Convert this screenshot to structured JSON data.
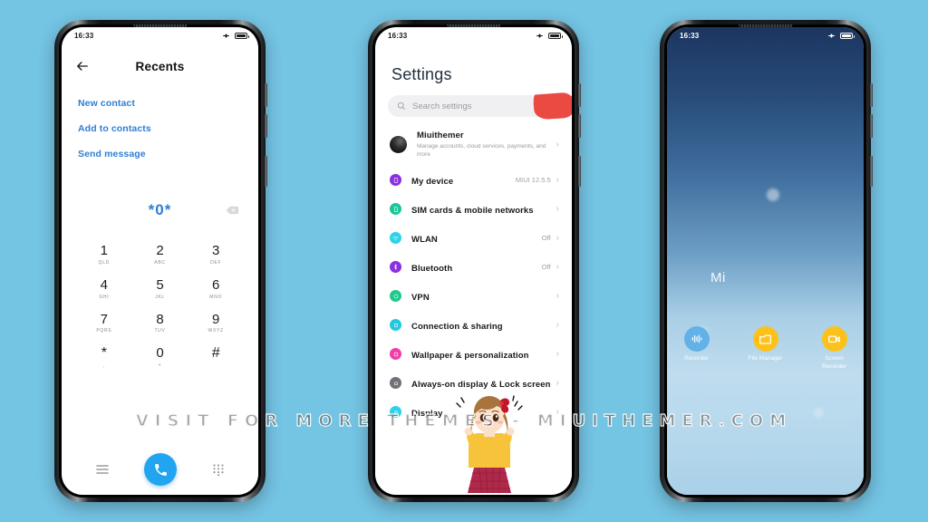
{
  "background_color": "#74c4e4",
  "watermark": {
    "text": "VISIT  FOR  MORE  THEMES  -  MIUITHEMER.COM"
  },
  "phones": {
    "dialer": {
      "status_bar": {
        "time": "16:33",
        "icons": [
          "airplane-mode-icon",
          "battery-icon"
        ]
      },
      "header": {
        "back_label": "back-arrow-icon",
        "title": "Recents"
      },
      "actions": [
        {
          "label": "New contact"
        },
        {
          "label": "Add to contacts"
        },
        {
          "label": "Send message"
        }
      ],
      "display": {
        "number": "*0*",
        "delete_label": "backspace-icon"
      },
      "keys": [
        {
          "digit": "1",
          "letters": "QLD"
        },
        {
          "digit": "2",
          "letters": "ABC"
        },
        {
          "digit": "3",
          "letters": "DEF"
        },
        {
          "digit": "4",
          "letters": "GHI"
        },
        {
          "digit": "5",
          "letters": "JKL"
        },
        {
          "digit": "6",
          "letters": "MNO"
        },
        {
          "digit": "7",
          "letters": "PQRS"
        },
        {
          "digit": "8",
          "letters": "TUV"
        },
        {
          "digit": "9",
          "letters": "WXYZ"
        },
        {
          "digit": "*",
          "letters": ","
        },
        {
          "digit": "0",
          "letters": "+"
        },
        {
          "digit": "#",
          "letters": ""
        }
      ],
      "bottom_bar": {
        "menu_label": "menu-icon",
        "call_label": "call-icon",
        "keypad_label": "keypad-icon",
        "call_button_color": "#21a5f1"
      },
      "link_color": "#2e7fd4"
    },
    "settings": {
      "status_bar": {
        "time": "16:33",
        "icons": [
          "airplane-mode-icon",
          "battery-icon"
        ]
      },
      "title": "Settings",
      "search": {
        "placeholder": "Search settings",
        "icon": "search-icon"
      },
      "blob_color": "#ea4a42",
      "items": [
        {
          "label": "Miuithemer",
          "sub": "Manage accounts, cloud services, payments, and more",
          "value": "",
          "icon": "account-avatar",
          "icon_color": "#2b2b2b"
        },
        {
          "label": "My device",
          "sub": "",
          "value": "MIUI 12.5.5",
          "icon": "phone-icon",
          "icon_color": "#8b2fe0"
        },
        {
          "label": "SIM cards & mobile networks",
          "sub": "",
          "value": "",
          "icon": "sim-card-icon",
          "icon_color": "#19c79a"
        },
        {
          "label": "WLAN",
          "sub": "",
          "value": "Off",
          "icon": "wifi-icon",
          "icon_color": "#2fd2e8"
        },
        {
          "label": "Bluetooth",
          "sub": "",
          "value": "Off",
          "icon": "bluetooth-icon",
          "icon_color": "#8b2fe0"
        },
        {
          "label": "VPN",
          "sub": "",
          "value": "",
          "icon": "vpn-icon",
          "icon_color": "#1fc98c"
        },
        {
          "label": "Connection & sharing",
          "sub": "",
          "value": "",
          "icon": "connection-sharing-icon",
          "icon_color": "#22c8de"
        },
        {
          "label": "Wallpaper & personalization",
          "sub": "",
          "value": "",
          "icon": "wallpaper-icon",
          "icon_color": "#ef3fa6"
        },
        {
          "label": "Always-on display & Lock screen",
          "sub": "",
          "value": "",
          "icon": "lock-screen-icon",
          "icon_color": "#6f7277"
        },
        {
          "label": "Display",
          "sub": "",
          "value": "",
          "icon": "display-icon",
          "icon_color": "#2fd2e8"
        }
      ]
    },
    "home": {
      "status_bar": {
        "time": "16:33",
        "icons": [
          "airplane-mode-icon",
          "battery-icon"
        ]
      },
      "widget_text": "Mi",
      "apps": [
        {
          "label": "Recorder",
          "icon": "recorder-icon",
          "color": "#62b2e8"
        },
        {
          "label": "File Manager",
          "icon": "folder-icon",
          "color": "#fcc21b"
        },
        {
          "label": "Screen Recorder",
          "icon": "video-camera-icon",
          "color": "#fcc21b"
        }
      ]
    }
  }
}
